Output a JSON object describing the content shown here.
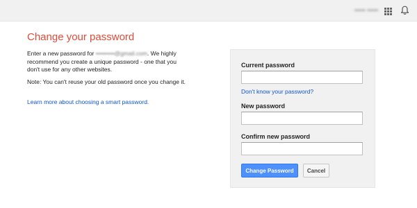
{
  "header": {
    "account_name": "••••• •••••",
    "apps_icon": "apps-grid-icon",
    "notifications_icon": "bell-icon",
    "background_color": "#f1f1f1"
  },
  "main": {
    "title": "Change your password",
    "title_color": "#dd4b39",
    "intro_before_email": "Enter a new password for",
    "email_placeholder": "•••••••••@gmail.com",
    "intro_after_email": ". We highly recommend you create a unique password - one that you don't use for any other websites.",
    "note": "Note: You can't reuse your old password once you change it.",
    "learn_more_link": "Learn more about choosing a smart password.",
    "link_color": "#1155cc"
  },
  "form": {
    "current_password_label": "Current password",
    "current_password_value": "",
    "forgot_password_link": "Don't know your password?",
    "new_password_label": "New password",
    "new_password_value": "",
    "confirm_password_label": "Confirm new password",
    "confirm_password_value": "",
    "submit_label": "Change Password",
    "cancel_label": "Cancel",
    "primary_button_color": "#4d90fe"
  }
}
